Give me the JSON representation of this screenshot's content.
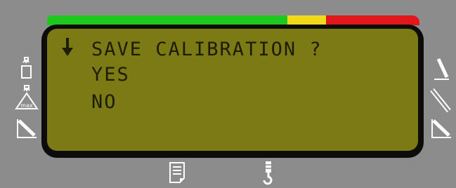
{
  "load_bar": {
    "colors": {
      "safe": "#1fc81f",
      "warning": "#f0d81a",
      "overload": "#e2171c"
    }
  },
  "screen": {
    "background": "#7c7a14",
    "text_color": "#1d1d06",
    "cursor_icon": "down-arrow",
    "lines": [
      "SAVE CALIBRATION ?",
      "YES",
      "NO"
    ]
  },
  "left_icons": [
    "weight-small-icon",
    "max-load-icon",
    "boom-angle-icon"
  ],
  "right_icons": [
    "boom-length-icon",
    "telescopic-boom-icon",
    "boom-radius-icon"
  ],
  "bottom_icons": [
    "document-icon",
    "hook-icon"
  ]
}
